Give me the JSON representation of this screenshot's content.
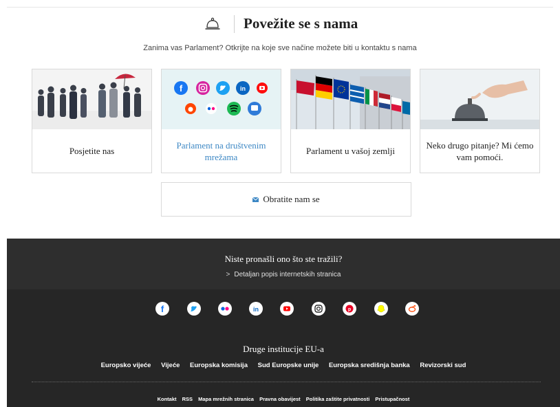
{
  "contact": {
    "title": "Povežite se s nama",
    "subtitle": "Zanima vas Parlament? Otkrijte na koje sve načine možete biti u kontaktu s nama",
    "cards": [
      {
        "label": "Posjetite nas",
        "is_link": false
      },
      {
        "label": "Parlament na društvenim mrežama",
        "is_link": true
      },
      {
        "label": "Parlament u vašoj zemlji",
        "is_link": false
      },
      {
        "label": "Neko drugo pitanje? Mi ćemo vam pomoći.",
        "is_link": false
      }
    ],
    "contact_button": "Obratite nam se"
  },
  "footer": {
    "not_found": "Niste pronašli ono što ste tražili?",
    "sitemap_link": "Detaljan popis internetskih stranica",
    "social_icons": [
      "facebook-icon",
      "twitter-icon",
      "flickr-icon",
      "linkedin-icon",
      "youtube-icon",
      "instagram-icon",
      "pinterest-icon",
      "snapchat-icon",
      "reddit-icon"
    ],
    "other_institutions_title": "Druge institucije EU-a",
    "institutions": [
      "Europsko vijeće",
      "Vijeće",
      "Europska komisija",
      "Sud Europske unije",
      "Europska središnja banka",
      "Revizorski sud"
    ],
    "legal_links": [
      "Kontakt",
      "RSS",
      "Mapa mrežnih stranica",
      "Pravna obavijest",
      "Politika zaštite privatnosti",
      "Pristupačnost"
    ]
  },
  "colors": {
    "link_blue": "#3c87c4",
    "footer_bg": "#262626",
    "footer_top_bg": "#2e2e2e",
    "card_border": "#d9d9d9"
  }
}
